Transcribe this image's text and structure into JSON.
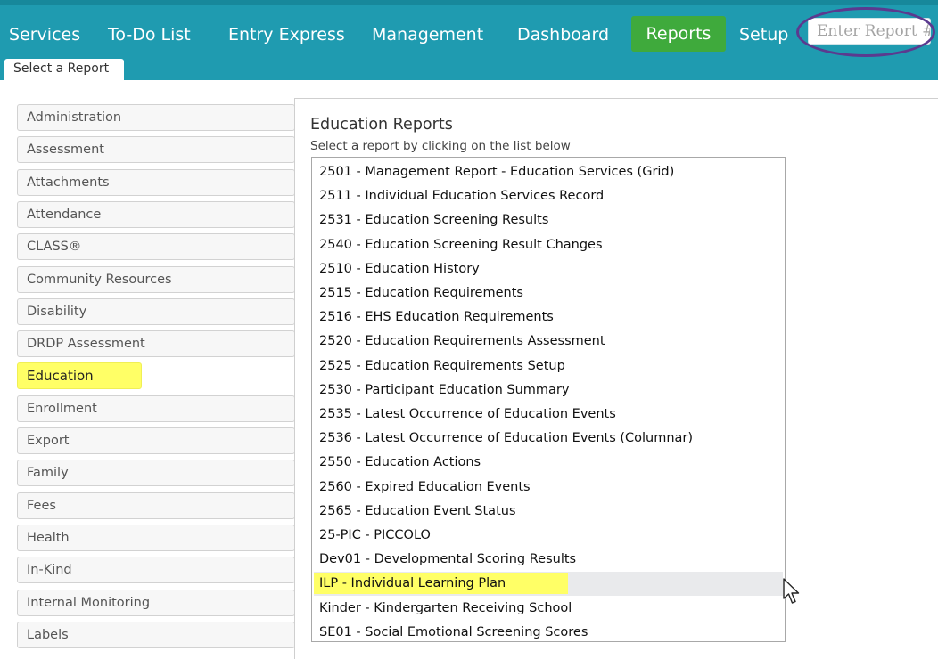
{
  "nav": {
    "items": [
      {
        "label": "Services"
      },
      {
        "label": "To-Do List"
      },
      {
        "label": "Entry Express"
      },
      {
        "label": "Management"
      },
      {
        "label": "Dashboard"
      },
      {
        "label": "Reports",
        "active": true
      },
      {
        "label": "Setup"
      }
    ],
    "report_input_placeholder": "Enter Report #"
  },
  "subnav": {
    "tab_label": "Select a Report"
  },
  "categories": [
    "Administration",
    "Assessment",
    "Attachments",
    "Attendance",
    "CLASS®",
    "Community Resources",
    "Disability",
    "DRDP Assessment",
    "Education",
    "Enrollment",
    "Export",
    "Family",
    "Fees",
    "Health",
    "In-Kind",
    "Internal Monitoring",
    "Labels"
  ],
  "selected_category": "Education",
  "panel": {
    "title": "Education Reports",
    "subtitle": "Select a report by clicking on the list below"
  },
  "reports": [
    "2501 - Management Report - Education Services (Grid)",
    "2511 - Individual Education Services Record",
    "2531 - Education Screening Results",
    "2540 - Education Screening Result Changes",
    "2510 - Education History",
    "2515 - Education Requirements",
    "2516 - EHS Education Requirements",
    "2520 - Education Requirements Assessment",
    "2525 - Education Requirements Setup",
    "2530 - Participant Education Summary",
    "2535 - Latest Occurrence of Education Events",
    "2536 - Latest Occurrence of Education Events (Columnar)",
    "2550 - Education Actions",
    "2560 - Expired Education Events",
    "2565 - Education Event Status",
    "25-PIC - PICCOLO",
    "Dev01 - Developmental Scoring Results",
    "ILP - Individual Learning Plan",
    "Kinder - Kindergarten Receiving School",
    "SE01 - Social Emotional Screening Scores"
  ],
  "highlighted_report": "ILP - Individual Learning Plan",
  "colors": {
    "nav_bg": "#1f9bb0",
    "active_tab": "#3faa3c",
    "highlight": "#ffff66",
    "annotation_ellipse": "#5b3a8f"
  }
}
